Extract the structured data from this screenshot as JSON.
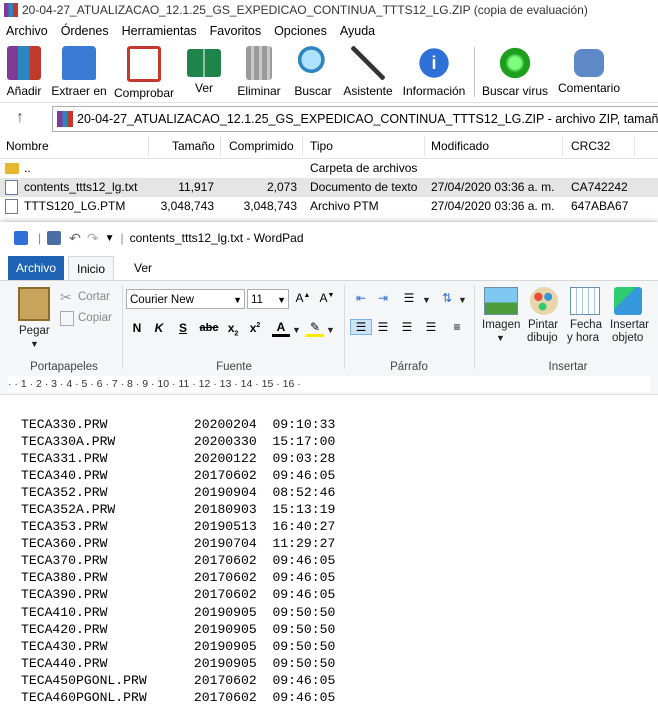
{
  "winrar": {
    "title": "20-04-27_ATUALIZACAO_12.1.25_GS_EXPEDICAO_CONTINUA_TTTS12_LG.ZIP (copia de evaluación)",
    "menu": [
      "Archivo",
      "Órdenes",
      "Herramientas",
      "Favoritos",
      "Opciones",
      "Ayuda"
    ],
    "toolbar": [
      {
        "label": "Añadir",
        "icon": "add-archive-icon",
        "color": "#c0392b"
      },
      {
        "label": "Extraer en",
        "icon": "extract-folder-icon",
        "color": "#3a7bd5"
      },
      {
        "label": "Comprobar",
        "icon": "test-clipboard-icon",
        "color": "#c0392b"
      },
      {
        "label": "Ver",
        "icon": "view-book-icon",
        "color": "#27ae60"
      },
      {
        "label": "Eliminar",
        "icon": "trash-icon",
        "color": "#8a8a8a"
      },
      {
        "label": "Buscar",
        "icon": "magnifier-icon",
        "color": "#2e86c1"
      },
      {
        "label": "Asistente",
        "icon": "wizard-wand-icon",
        "color": "#8e44ad"
      },
      {
        "label": "Información",
        "icon": "info-icon",
        "color": "#2e6fd8"
      },
      {
        "label": "Buscar virus",
        "icon": "virus-scan-icon",
        "color": "#2ecc40"
      },
      {
        "label": "Comentario",
        "icon": "comment-icon",
        "color": "#5d8ac6"
      }
    ],
    "address": "20-04-27_ATUALIZACAO_12.1.25_GS_EXPEDICAO_CONTINUA_TTTS12_LG.ZIP - archivo ZIP, tamaño descomprim",
    "columns": {
      "name": "Nombre",
      "size": "Tamaño",
      "compressed": "Comprimido",
      "type": "Tipo",
      "modified": "Modificado",
      "crc": "CRC32"
    },
    "files": [
      {
        "name": "..",
        "size": "",
        "compressed": "",
        "type": "Carpeta de archivos",
        "modified": "",
        "crc": "",
        "icon": "folder-icon"
      },
      {
        "name": "contents_ttts12_lg.txt",
        "size": "11,917",
        "compressed": "2,073",
        "type": "Documento de texto",
        "modified": "27/04/2020 03:36 a. m.",
        "crc": "CA742242",
        "icon": "text-file-icon"
      },
      {
        "name": "TTTS120_LG.PTM",
        "size": "3,048,743",
        "compressed": "3,048,743",
        "type": "Archivo PTM",
        "modified": "27/04/2020 03:36 a. m.",
        "crc": "647ABA67",
        "icon": "file-icon"
      }
    ]
  },
  "wordpad": {
    "title": "contents_ttts12_lg.txt - WordPad",
    "tabs": {
      "file": "Archivo",
      "home": "Inicio",
      "view": "Ver"
    },
    "clipboard": {
      "paste": "Pegar",
      "cut": "Cortar",
      "copy": "Copiar",
      "group": "Portapapeles"
    },
    "font": {
      "family": "Courier New",
      "size": "11",
      "group": "Fuente"
    },
    "paragraph": {
      "group": "Párrafo"
    },
    "insert": {
      "image": "Imagen",
      "paint_1": "Pintar",
      "paint_2": "dibujo",
      "date_1": "Fecha",
      "date_2": "y hora",
      "object_1": "Insertar",
      "object_2": "objeto",
      "group": "Insertar"
    },
    "ruler": "·  ·  1  ·  2  ·  3  ·  4  ·  5  ·  6  ·  7  ·  8  ·  9  ·  10  ·  11  ·  12  ·  13  ·  14  ·  15  ·  16  ·",
    "lines": [
      "TECA330.PRW           20200204  09:10:33",
      "TECA330A.PRW          20200330  15:17:00",
      "TECA331.PRW           20200122  09:03:28",
      "TECA340.PRW           20170602  09:46:05",
      "TECA352.PRW           20190904  08:52:46",
      "TECA352A.PRW          20180903  15:13:19",
      "TECA353.PRW           20190513  16:40:27",
      "TECA360.PRW           20190704  11:29:27",
      "TECA370.PRW           20170602  09:46:05",
      "TECA380.PRW           20170602  09:46:05",
      "TECA390.PRW           20170602  09:46:05",
      "TECA410.PRW           20190905  09:50:50",
      "TECA420.PRW           20190905  09:50:50",
      "TECA430.PRW           20190905  09:50:50",
      "TECA440.PRW           20190905  09:50:50",
      "TECA450PGONL.PRW      20170602  09:46:05",
      "TECA460PGONL.PRW      20170602  09:46:05"
    ]
  }
}
